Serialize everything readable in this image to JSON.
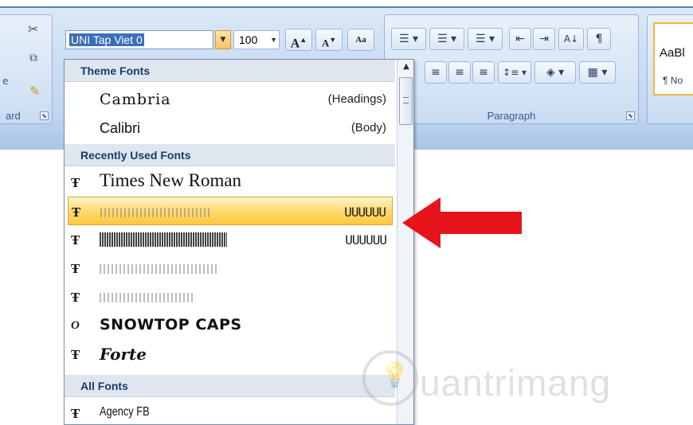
{
  "clipboard": {
    "cut_icon": "scissors-icon",
    "copy_icon": "copy-icon",
    "painter_icon": "format-painter-icon",
    "group_label": "ard",
    "launcher": "⬊",
    "paste_edge": "e"
  },
  "font": {
    "name_value": "UNI Tap Viet 0",
    "size_value": "100",
    "grow_label": "A",
    "shrink_label": "A",
    "clear_label": "Aa"
  },
  "paragraph": {
    "group_label": "Paragraph",
    "launcher": "⬊",
    "bullets": "☰",
    "numbering": "☰",
    "multilevel": "☰",
    "decrease_indent": "⇤",
    "increase_indent": "⇥",
    "sort": "A↓",
    "show_marks": "¶",
    "align_center": "≡",
    "align_right": "≡",
    "justify": "≡",
    "line_spacing": "↕≡",
    "shading": "◈",
    "borders": "▦"
  },
  "styles": {
    "sample": "AaBl",
    "name": "¶ No"
  },
  "dropdown": {
    "theme_header": "Theme Fonts",
    "theme_fonts": [
      {
        "name": "Cambria",
        "note": "(Headings)"
      },
      {
        "name": "Calibri",
        "note": "(Body)"
      }
    ],
    "recent_header": "Recently Used Fonts",
    "recent_fonts": [
      {
        "name": "Times New Roman",
        "note": ""
      },
      {
        "name": "",
        "note": "UUUUUU"
      },
      {
        "name": "",
        "note": "UUUUUU"
      },
      {
        "name": "",
        "note": ""
      },
      {
        "name": "",
        "note": ""
      },
      {
        "name": "SNOWTOP CAPS",
        "note": ""
      },
      {
        "name": "Forte",
        "note": ""
      }
    ],
    "all_header": "All Fonts",
    "all_fonts": [
      {
        "name": "Agency FB",
        "note": ""
      }
    ],
    "tt_glyph": "Ŧ",
    "ot_glyph": "O"
  },
  "colors": {
    "selection_highlight": "#ffd76a",
    "arrow": "#e8141b",
    "header_bg": "#dfe6ef"
  },
  "watermark": {
    "text": "uantrimang",
    "icon": "lightbulb-icon"
  }
}
